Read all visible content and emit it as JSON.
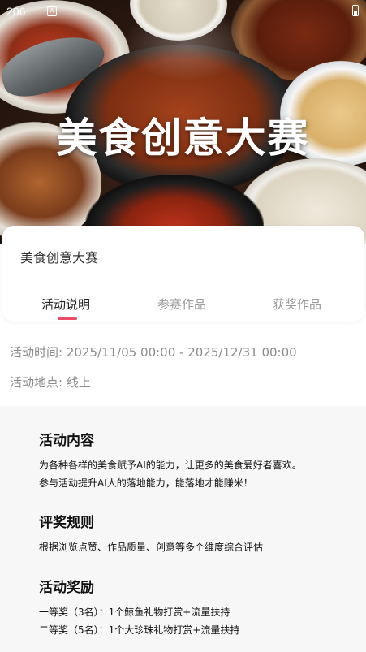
{
  "status_bar": {
    "time": "206",
    "notification_icon_letter": "A"
  },
  "hero": {
    "title": "美食创意大赛"
  },
  "card": {
    "title": "美食创意大赛",
    "tabs": [
      {
        "label": "活动说明",
        "active": true
      },
      {
        "label": "参赛作品",
        "active": false
      },
      {
        "label": "获奖作品",
        "active": false
      }
    ]
  },
  "info": {
    "time": "活动时间: 2025/11/05 00:00 - 2025/12/31 00:00",
    "place": "活动地点: 线上"
  },
  "sections": [
    {
      "title": "活动内容",
      "lines": [
        "为各种各样的美食赋予AI的能力，让更多的美食爱好者喜欢。",
        "参与活动提升AI人的落地能力，能落地才能赚米！"
      ]
    },
    {
      "title": "评奖规则",
      "lines": [
        "根据浏览点赞、作品质量、创意等多个维度综合评估"
      ]
    },
    {
      "title": "活动奖励",
      "lines": [
        "一等奖（3名）：1个鲸鱼礼物打赏+流量扶持",
        "二等奖（5名）：1个大珍珠礼物打赏+流量扶持"
      ]
    }
  ],
  "colors": {
    "accent": "#ec4b6a",
    "tab_inactive": "#9a9a9a",
    "info_text": "#8c8c8c",
    "content_bg": "#f7f7f8"
  }
}
